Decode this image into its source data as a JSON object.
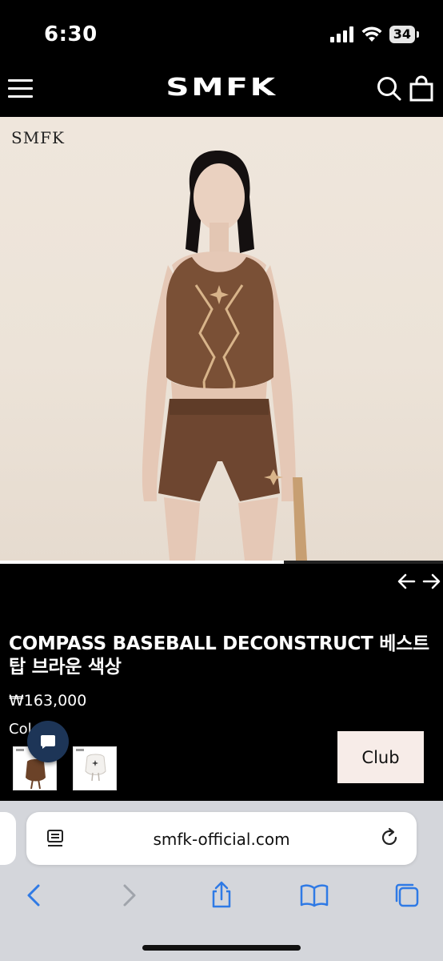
{
  "status_bar": {
    "time": "6:30",
    "battery": "34"
  },
  "header": {
    "logo": "SMFK"
  },
  "gallery": {
    "watermark": "SMFK",
    "progress": 0.64
  },
  "product": {
    "title": "COMPASS BASEBALL DECONSTRUCT 베스트 탑 브라운 색상",
    "price": "₩163,000",
    "color_label_visible": "Col",
    "swatches": [
      {
        "color": "brown"
      },
      {
        "color": "white"
      }
    ],
    "club_button": "Club"
  },
  "browser": {
    "url": "smfk-official.com"
  },
  "colors": {
    "accent": "#1d3557",
    "button_bg": "#f7ece8",
    "toolbar_icon": "#2f7ae5",
    "toolbar_disabled": "#a0a4ab"
  }
}
